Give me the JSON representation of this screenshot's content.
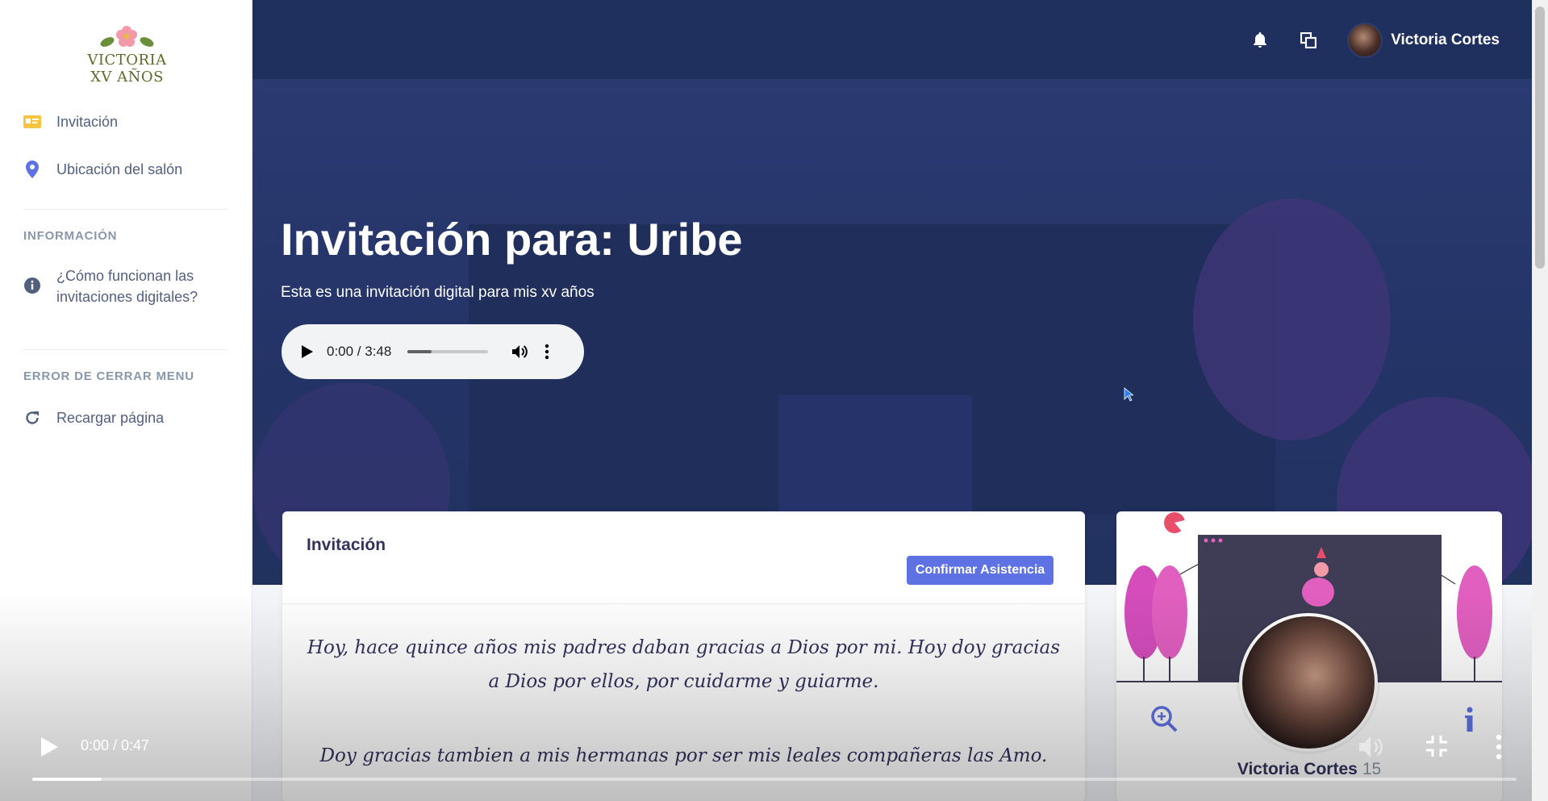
{
  "sidebar": {
    "brand": "VICTORIA XV AÑOS",
    "items": [
      {
        "label": "Invitación",
        "icon": "id-card-icon"
      },
      {
        "label": "Ubicación del salón",
        "icon": "map-pin-icon"
      }
    ],
    "section_info": {
      "heading": "INFORMACIÓN",
      "item_label": "¿Cómo funcionan las invitaciones digitales?",
      "item_line1": "¿Cómo funcionan las",
      "item_line2": "invitaciones digitales?"
    },
    "section_error": {
      "heading": "ERROR DE CERRAR MENU",
      "item_label": "Recargar página"
    }
  },
  "topbar": {
    "user_name": "Victoria Cortes"
  },
  "hero": {
    "title": "Invitación para: Uribe",
    "subtitle": "Esta es una invitación digital para mis xv años"
  },
  "audio": {
    "time": "0:00 / 3:48",
    "progress": 0.3
  },
  "card": {
    "title": "Invitación",
    "confirm_label": "Confirmar Asistencia",
    "paragraph1": "Hoy, hace quince años mis padres daban gracias a Dios por mi. Hoy doy gracias a Dios por ellos, por cuidarme y guiarme.",
    "paragraph2": "Doy gracias tambien a mis hermanas por ser mis leales compañeras las Amo."
  },
  "profile": {
    "name": "Victoria Cortes",
    "age": "15"
  },
  "video": {
    "time": "0:00 / 0:47",
    "progress": 0.047
  },
  "colors": {
    "primary": "#5e72e4",
    "hero": "#233365",
    "accent_pink": "#e15fbf"
  }
}
